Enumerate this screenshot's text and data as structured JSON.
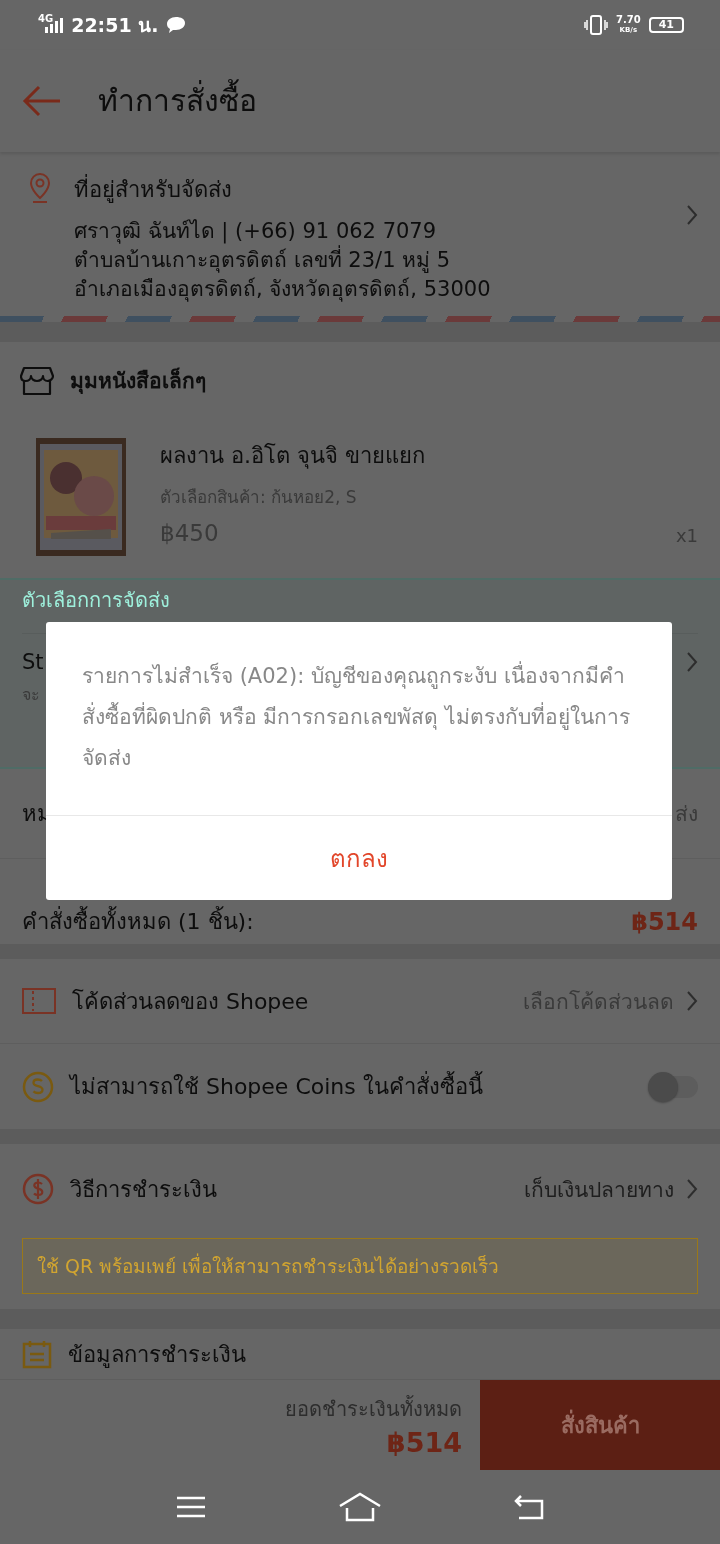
{
  "status_bar": {
    "network": "4G",
    "time": "22:51 น.",
    "speed": "7.70",
    "speed_unit": "KB/s",
    "battery": "41"
  },
  "header": {
    "title": "ทำการสั่งซื้อ"
  },
  "address": {
    "heading": "ที่อยู่สำหรับจัดส่ง",
    "lines": [
      "ศราวุฒิ ฉันท์ได | (+66) 91 062 7079",
      "ตำบลบ้านเกาะอุตรดิตถ์ เลขที่ 23/1 หมู่ 5",
      "อำเภอเมืองอุตรดิตถ์, จังหวัดอุตรดิตถ์, 53000"
    ]
  },
  "shop": {
    "name": "มุมหนังสือเล็กๆ"
  },
  "product": {
    "name": "ผลงาน อ.อิโต จุนจิ ขายแยก",
    "variant": "ตัวเลือกสินค้า: ก้นหอย2, S",
    "price": "฿450",
    "quantity": "x1"
  },
  "shipping": {
    "heading": "ตัวเลือกการจัดส่ง",
    "option": "St",
    "option_note": "จะ"
  },
  "note": {
    "label": "หม",
    "value": "ส่ง"
  },
  "order_total": {
    "label": "คำสั่งซื้อทั้งหมด (1 ชิ้น):",
    "amount": "฿514"
  },
  "voucher": {
    "label": "โค้ดส่วนลดของ Shopee",
    "action": "เลือกโค้ดส่วนลด"
  },
  "coins": {
    "label": "ไม่สามารถใช้ Shopee Coins ในคำสั่งซื้อนี้",
    "on": false
  },
  "payment": {
    "label": "วิธีการชำระเงิน",
    "value": "เก็บเงินปลายทาง",
    "banner": "ใช้ QR พร้อมเพย์ เพื่อให้สามารถชำระเงินได้อย่างรวดเร็ว"
  },
  "payment_info": {
    "label": "ข้อมูลการชำระเงิน"
  },
  "bottom_bar": {
    "total_label": "ยอดชำระเงินทั้งหมด",
    "total": "฿514",
    "order_button": "สั่งสินค้า"
  },
  "dialog": {
    "message": "รายการไม่สำเร็จ (A02): บัญชีของคุณถูกระงับ เนื่องจากมีคำสั่งซื้อที่ผิดปกติ หรือ มีการกรอกเลขพัสดุ ไม่ตรงกับที่อยู่ในการจัดส่ง",
    "button": "ตกลง"
  }
}
